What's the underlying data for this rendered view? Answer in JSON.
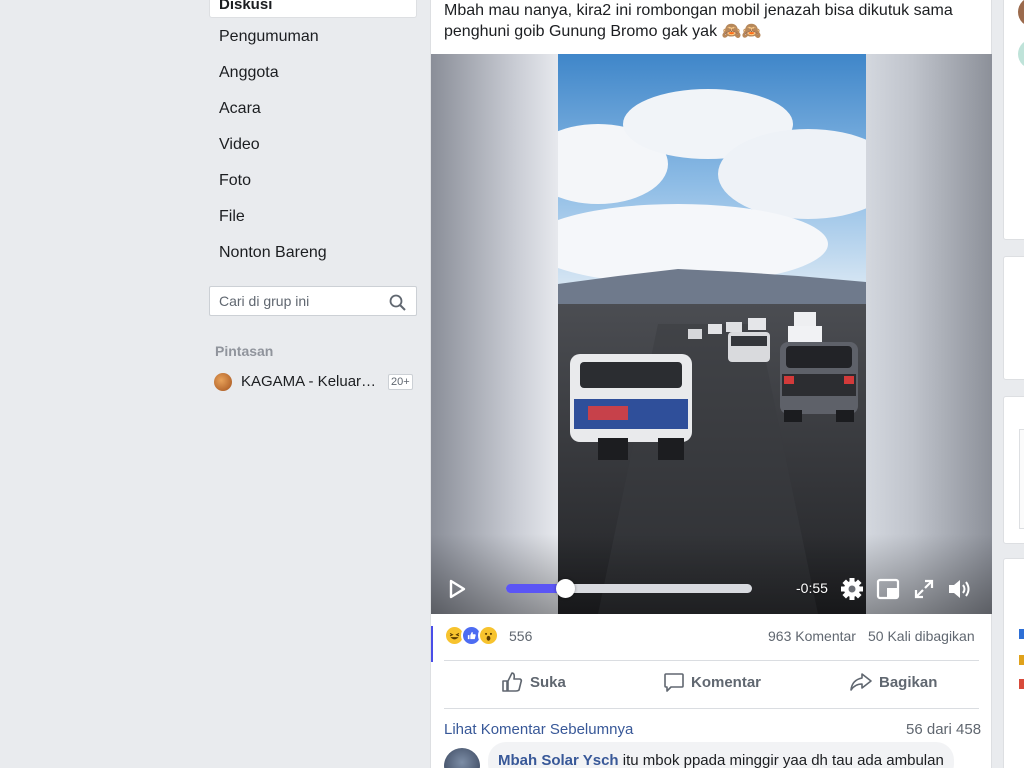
{
  "nav": {
    "active": "Diskusi",
    "items": [
      "Pengumuman",
      "Anggota",
      "Acara",
      "Video",
      "Foto",
      "File",
      "Nonton Bareng"
    ]
  },
  "search": {
    "placeholder": "Cari di grup ini"
  },
  "shortcuts": {
    "title": "Pintasan",
    "items": [
      {
        "label": "KAGAMA - Keluarga Alumni Universitas Gadjah Mada",
        "badge": "20+"
      }
    ]
  },
  "post": {
    "text": "Mbah mau nanya, kira2 ini rombongan mobil jenazah bisa dikutuk sama penghuni goib Gunung Bromo gak yak 🙈🙈",
    "video": {
      "time_remaining": "-0:55",
      "progress": 0.24
    },
    "reactions": {
      "count": "556",
      "types": [
        "haha",
        "like",
        "wow"
      ]
    },
    "comments_count": "963 Komentar",
    "shares_count": "50 Kali dibagikan",
    "actions": {
      "like": "Suka",
      "comment": "Komentar",
      "share": "Bagikan"
    },
    "previous_comments": "Lihat Komentar Sebelumnya",
    "comment_position": "56 dari 458",
    "comment": {
      "author": "Mbah Solar Ysch",
      "text": "itu mbok ppada minggir yaa dh tau ada ambulan"
    }
  },
  "colors": {
    "accent": "#4a4ee8",
    "link": "#385898",
    "progress": "#5b55f5"
  }
}
